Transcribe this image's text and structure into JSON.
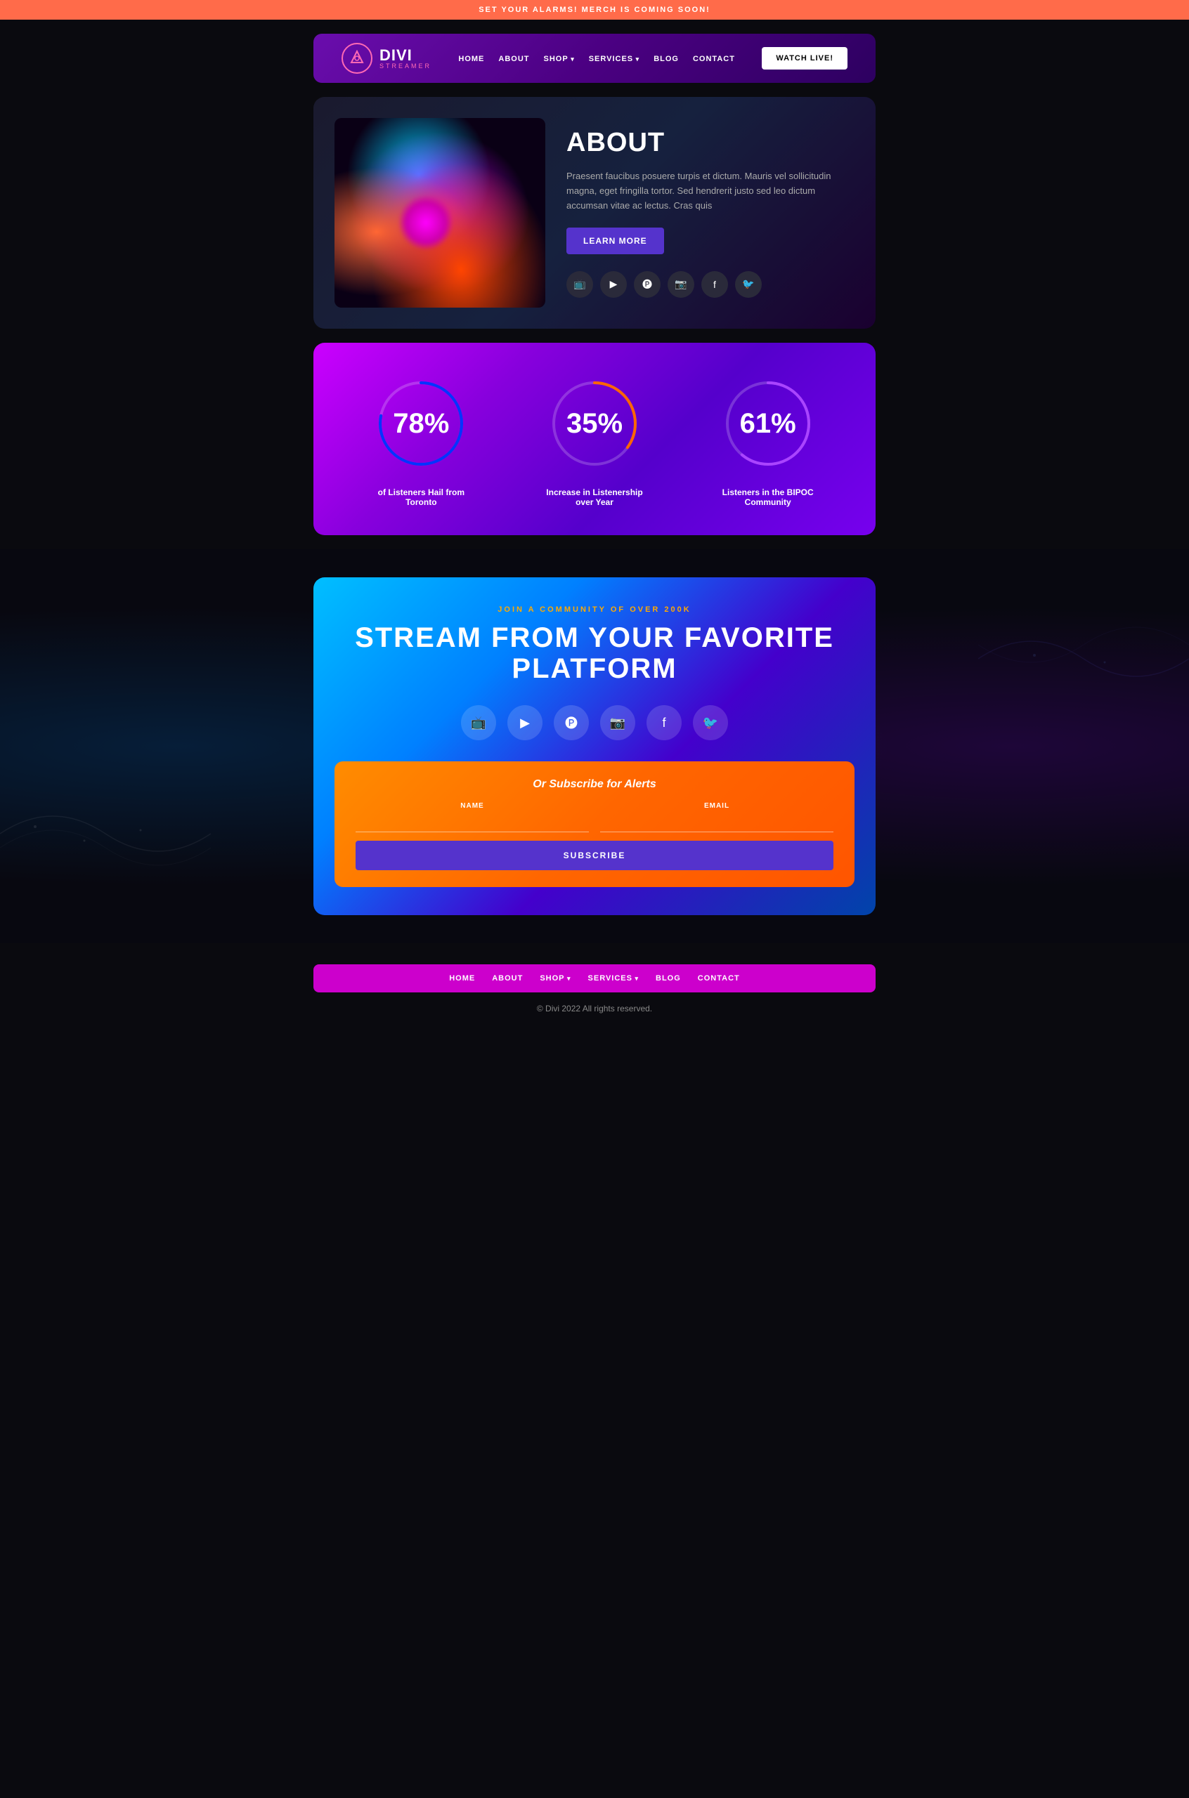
{
  "topBanner": {
    "text": "SET YOUR ALARMS! MERCH IS COMING SOON!"
  },
  "navbar": {
    "logo": {
      "title": "DIVI",
      "subtitle": "STREAMER",
      "icon": "🔺"
    },
    "nav": [
      {
        "label": "HOME",
        "dropdown": false
      },
      {
        "label": "ABOUT",
        "dropdown": false
      },
      {
        "label": "SHOP",
        "dropdown": true
      },
      {
        "label": "SERVICES",
        "dropdown": true
      },
      {
        "label": "BLOG",
        "dropdown": false
      },
      {
        "label": "CONTACT",
        "dropdown": false
      }
    ],
    "watchButton": "WATCH LIVE!"
  },
  "about": {
    "title": "ABOUT",
    "text": "Praesent faucibus posuere turpis et dictum. Mauris vel sollicitudin magna, eget fringilla tortor. Sed hendrerit justo sed leo dictum accumsan vitae ac lectus. Cras quis",
    "learnMoreButton": "LEARN MORE",
    "socials": [
      {
        "name": "twitch",
        "icon": "📺"
      },
      {
        "name": "youtube",
        "icon": "▶"
      },
      {
        "name": "patreon",
        "icon": "🅟"
      },
      {
        "name": "instagram",
        "icon": "📷"
      },
      {
        "name": "facebook",
        "icon": "f"
      },
      {
        "name": "twitter",
        "icon": "🐦"
      }
    ]
  },
  "stats": [
    {
      "number": "78%",
      "label": "of Listeners Hail from Toronto",
      "percent": 78,
      "strokeColor": "#0033ff",
      "trailColor": "rgba(255,255,255,0.2)"
    },
    {
      "number": "35%",
      "label": "Increase in Listenership over Year",
      "percent": 35,
      "strokeColor": "#ff6600",
      "trailColor": "rgba(255,255,255,0.2)"
    },
    {
      "number": "61%",
      "label": "Listeners in the BIPOC Community",
      "percent": 61,
      "strokeColor": "#aa44ff",
      "trailColor": "rgba(255,255,255,0.2)"
    }
  ],
  "stream": {
    "eyebrow": "JOIN A COMMUNITY OF OVER 200K",
    "title": "STREAM FROM YOUR FAVORITE PLATFORM",
    "socials": [
      {
        "name": "twitch",
        "icon": "📺"
      },
      {
        "name": "youtube",
        "icon": "▶"
      },
      {
        "name": "patreon",
        "icon": "🅟"
      },
      {
        "name": "instagram",
        "icon": "📷"
      },
      {
        "name": "facebook",
        "icon": "f"
      },
      {
        "name": "twitter",
        "icon": "🐦"
      }
    ]
  },
  "subscribe": {
    "title": "Or Subscribe for Alerts",
    "nameLabel": "NAME",
    "namePlaceholder": "",
    "emailLabel": "EMAIL",
    "emailPlaceholder": "",
    "buttonLabel": "SUBSCRIBE"
  },
  "footerNav": [
    {
      "label": "HOME",
      "dropdown": false
    },
    {
      "label": "ABOUT",
      "dropdown": false
    },
    {
      "label": "SHOP",
      "dropdown": true
    },
    {
      "label": "SERVICES",
      "dropdown": true
    },
    {
      "label": "BLOG",
      "dropdown": false
    },
    {
      "label": "CONTACT",
      "dropdown": false
    }
  ],
  "copyright": "© Divi 2022 All rights reserved."
}
